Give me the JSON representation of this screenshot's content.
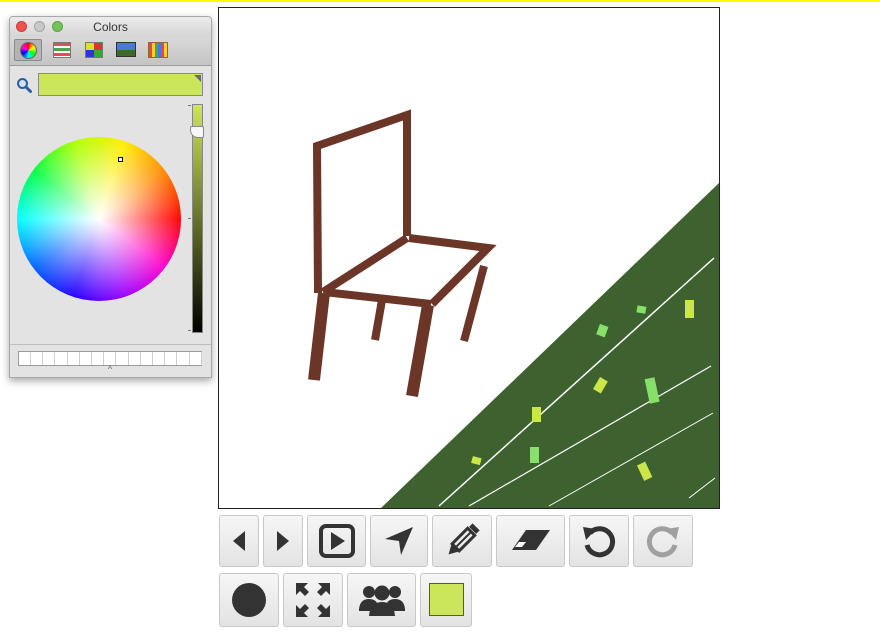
{
  "colors": {
    "top_line": "#ffff00",
    "selected_color": "#cce65a",
    "chair": "#6b3628",
    "grass": "#3d622f",
    "grass_light": "#ffffff",
    "confetti_yellow": "#cce64a",
    "confetti_green": "#86e06a",
    "icon_dark": "#333333",
    "icon_disabled": "#a0a0a0"
  },
  "color_panel": {
    "title": "Colors",
    "tabs": [
      "color-wheel-icon",
      "sliders-icon",
      "palettes-icon",
      "image-icon",
      "crayons-icon"
    ],
    "active_tab": 0,
    "swatch_slots": 15
  },
  "toolbar": {
    "row1": [
      {
        "name": "previous-button",
        "icon": "triangle-left-icon",
        "enabled": true
      },
      {
        "name": "next-button",
        "icon": "triangle-right-icon",
        "enabled": true
      },
      {
        "name": "play-button",
        "icon": "play-square-icon",
        "enabled": true
      },
      {
        "name": "move-button",
        "icon": "navigation-arrow-icon",
        "enabled": true
      },
      {
        "name": "pencil-button",
        "icon": "pencil-icon",
        "enabled": true
      },
      {
        "name": "eraser-button",
        "icon": "eraser-icon",
        "enabled": true
      },
      {
        "name": "undo-button",
        "icon": "undo-icon",
        "enabled": true
      },
      {
        "name": "redo-button",
        "icon": "redo-icon",
        "enabled": false
      }
    ],
    "row2": [
      {
        "name": "brush-size-button",
        "icon": "circle-icon"
      },
      {
        "name": "fullscreen-button",
        "icon": "expand-arrows-icon"
      },
      {
        "name": "collaborate-button",
        "icon": "group-icon"
      },
      {
        "name": "color-button",
        "icon": "color-swatch-icon"
      }
    ]
  }
}
